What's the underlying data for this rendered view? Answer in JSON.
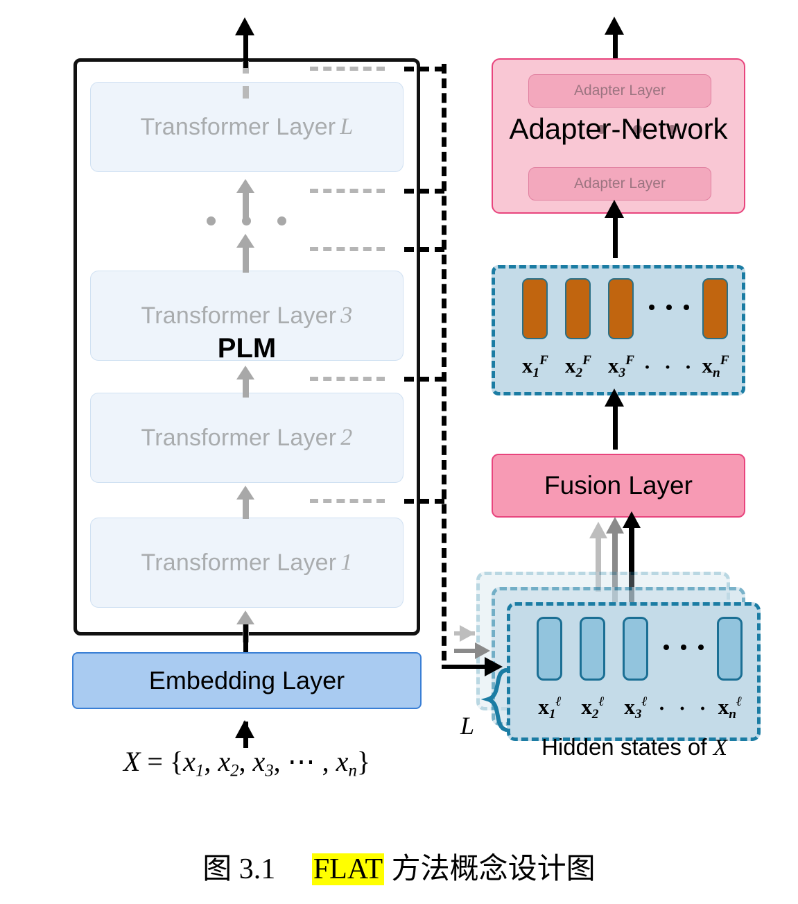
{
  "figure": {
    "caption_prefix": "图 3.1",
    "caption_highlight": "FLAT",
    "caption_suffix": "方法概念设计图"
  },
  "plm": {
    "label": "PLM",
    "layers": [
      {
        "name": "Transformer Layer",
        "index": "L"
      },
      {
        "name": "Transformer Layer",
        "index": "3"
      },
      {
        "name": "Transformer Layer",
        "index": "2"
      },
      {
        "name": "Transformer Layer",
        "index": "1"
      }
    ],
    "embedding_layer": "Embedding Layer",
    "input_formula": "X = {x1, x2, x3, ⋯ , xn}",
    "input_symbol": "X",
    "input_tokens": [
      "x1",
      "x2",
      "x3",
      "xn"
    ],
    "ellipsis": "⋯"
  },
  "adapter": {
    "title": "Adapter-Network",
    "layers": [
      "Adapter Layer",
      "Adapter Layer"
    ]
  },
  "fusion": {
    "label": "Fusion Layer"
  },
  "fusion_states": {
    "cells": [
      {
        "label_base": "x",
        "sub": "1",
        "sup": "F"
      },
      {
        "label_base": "x",
        "sub": "2",
        "sup": "F"
      },
      {
        "label_base": "x",
        "sub": "3",
        "sup": "F"
      },
      {
        "label_base": "x",
        "sub": "n",
        "sup": "F"
      }
    ],
    "ellipsis": "· · ·"
  },
  "hidden_states": {
    "caption_prefix": "Hidden states of",
    "caption_symbol": "X",
    "stack_label": "L",
    "cells": [
      {
        "label_base": "x",
        "sub": "1",
        "sup": "ℓ"
      },
      {
        "label_base": "x",
        "sub": "2",
        "sup": "ℓ"
      },
      {
        "label_base": "x",
        "sub": "3",
        "sup": "ℓ"
      },
      {
        "label_base": "x",
        "sub": "n",
        "sup": "ℓ"
      }
    ],
    "ellipsis": "· · ·"
  },
  "colors": {
    "plm_border": "#111111",
    "transformer_fill": "#eef4fb",
    "transformer_text": "#a9acae",
    "embedding_fill": "#a9cbf1",
    "embedding_border": "#3a7fd5",
    "adapter_fill": "#f9c7d4",
    "adapter_border": "#e8447d",
    "adapter_layer_fill": "#f3a8bd",
    "fusion_fill": "#f79ab4",
    "states_fill": "#c4dbe8",
    "states_border": "#1b7ca3",
    "fusion_cell": "#c1650f",
    "hidden_cell": "#92c4dd",
    "highlight": "#ffff00",
    "arrow_black": "#000000",
    "arrow_gray_light": "#bdbdbd",
    "arrow_gray_dark": "#8a8a8a"
  }
}
